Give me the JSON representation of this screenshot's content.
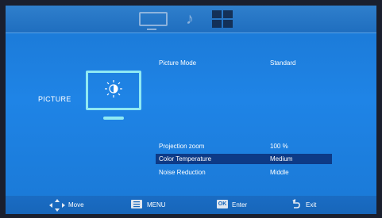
{
  "tabs": [
    {
      "icon": "monitor-icon"
    },
    {
      "icon": "music-note-icon"
    },
    {
      "icon": "grid-icon"
    }
  ],
  "section": {
    "label": "PICTURE",
    "icon": "picture-monitor-brightness-icon"
  },
  "menu": {
    "items": [
      {
        "label": "Picture Mode",
        "value": "Standard",
        "selected": false
      },
      {
        "label": "Projection zoom",
        "value": "100 %",
        "selected": false
      },
      {
        "label": "Color Temperature",
        "value": "Medium",
        "selected": true
      },
      {
        "label": "Noise Reduction",
        "value": "Middle",
        "selected": false
      }
    ]
  },
  "footer": {
    "move_label": "Move",
    "menu_label": "MENU",
    "ok_badge": "OK",
    "enter_label": "Enter",
    "exit_label": "Exit"
  },
  "colors": {
    "background_blue": "#1f84e6",
    "highlight": "#0d3a86",
    "illustration_cyan": "#8fe9f3"
  }
}
